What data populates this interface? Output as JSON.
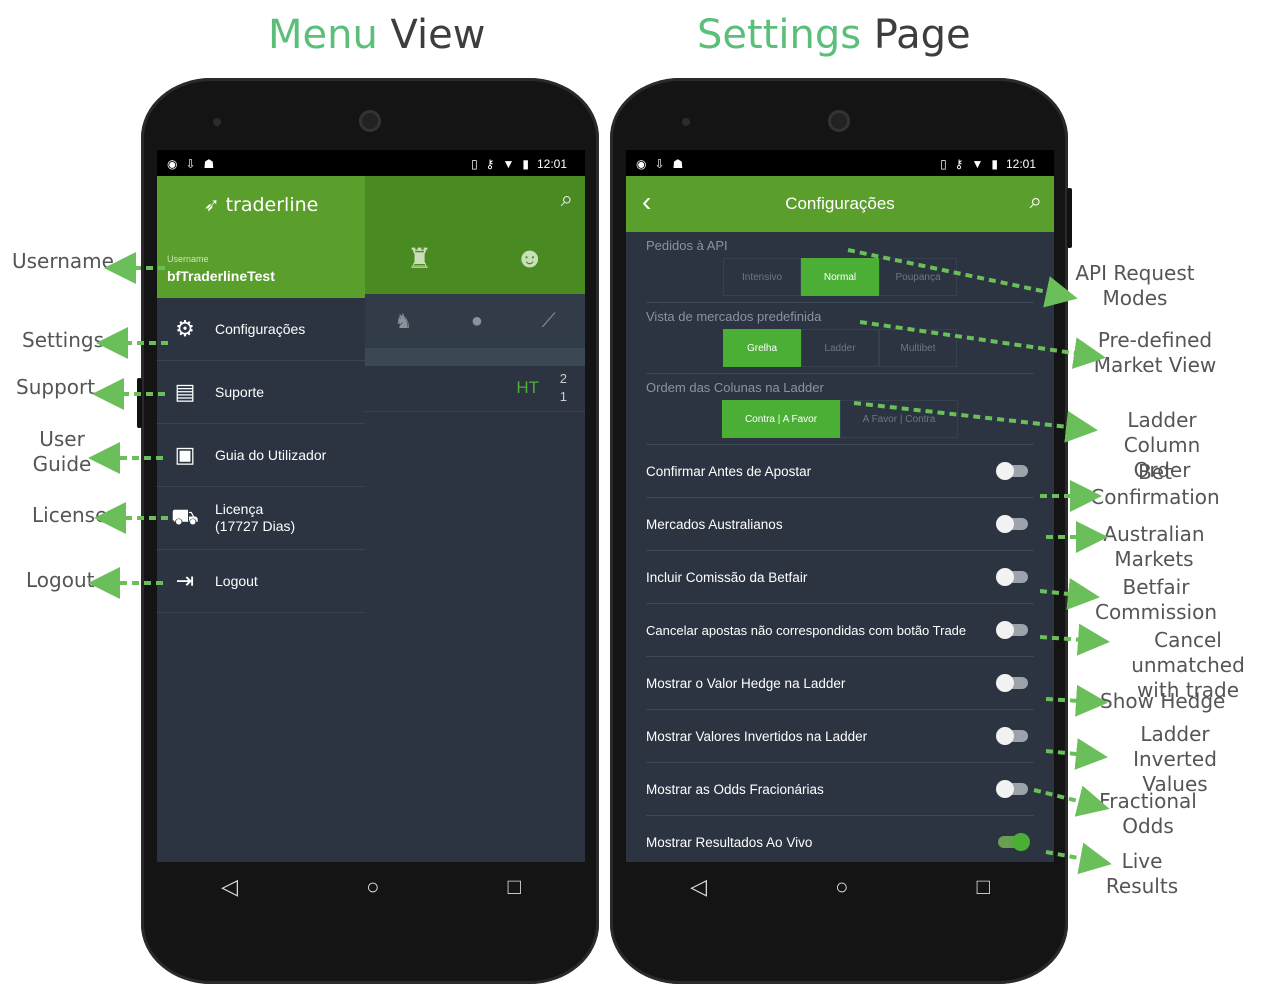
{
  "headings": {
    "left": {
      "accent": "Menu",
      "rest": "View"
    },
    "right": {
      "accent": "Settings",
      "rest": "Page"
    }
  },
  "colors": {
    "brand_green": "#5a9e2b",
    "accent_green": "#4caf35",
    "heading_green": "#5bbf7a",
    "arrow_green": "#6abf5a",
    "screen_bg": "#2b3440"
  },
  "status_bar": {
    "time": "12:01"
  },
  "menu_screen": {
    "logo": "traderline",
    "username_label": "Username",
    "username": "bfTraderlineTest",
    "items": [
      {
        "icon": "gear-icon",
        "label": "Configurações"
      },
      {
        "icon": "chat-icon",
        "label": "Suporte"
      },
      {
        "icon": "book-icon",
        "label": "Guia do Utilizador"
      },
      {
        "icon": "cart-icon",
        "label": "Licença",
        "sub": "(17727 Dias)"
      },
      {
        "icon": "logout-icon",
        "label": "Logout"
      }
    ],
    "background_row": {
      "status": "HT",
      "score_top": "2",
      "score_bottom": "1"
    }
  },
  "settings_screen": {
    "title": "Configurações",
    "sections": [
      {
        "title": "Pedidos à API",
        "options": [
          "Intensivo",
          "Normal",
          "Poupança"
        ],
        "selected": "Normal"
      },
      {
        "title": "Vista de mercados predefinida",
        "options": [
          "Grelha",
          "Ladder",
          "Multibet"
        ],
        "selected": "Grelha"
      },
      {
        "title": "Ordem das Colunas na Ladder",
        "options": [
          "Contra | A Favor",
          "A Favor | Contra"
        ],
        "selected": "Contra | A Favor"
      }
    ],
    "toggles": [
      {
        "label": "Confirmar Antes de Apostar",
        "on": false
      },
      {
        "label": "Mercados Australianos",
        "on": false
      },
      {
        "label": "Incluir Comissão da Betfair",
        "on": false
      },
      {
        "label": "Cancelar apostas não correspondidas com botão Trade",
        "on": false
      },
      {
        "label": "Mostrar o Valor Hedge na Ladder",
        "on": false
      },
      {
        "label": "Mostrar Valores Invertidos na Ladder",
        "on": false
      },
      {
        "label": "Mostrar as Odds Fracionárias",
        "on": false
      },
      {
        "label": "Mostrar Resultados Ao Vivo",
        "on": true
      }
    ]
  },
  "callouts_left": {
    "username": "Username",
    "settings": "Settings",
    "support": "Support",
    "user_guide_1": "User",
    "user_guide_2": "Guide",
    "license": "License",
    "logout": "Logout"
  },
  "callouts_right": {
    "api_1": "API Request",
    "api_2": "Modes",
    "market_1": "Pre-defined",
    "market_2": "Market View",
    "ladder_1": "Ladder Column",
    "ladder_2": "Order",
    "bet_1": "Bet",
    "bet_2": "Confirmation",
    "aus_1": "Australian",
    "aus_2": "Markets",
    "comm_1": "Betfair",
    "comm_2": "Commission",
    "cancel_1": "Cancel unmatched",
    "cancel_2": "with trade",
    "hedge": "Show Hedge",
    "inverted_1": "Ladder",
    "inverted_2": "Inverted Values",
    "fractional_1": "Fractional",
    "fractional_2": "Odds",
    "live_1": "Live",
    "live_2": "Results"
  }
}
